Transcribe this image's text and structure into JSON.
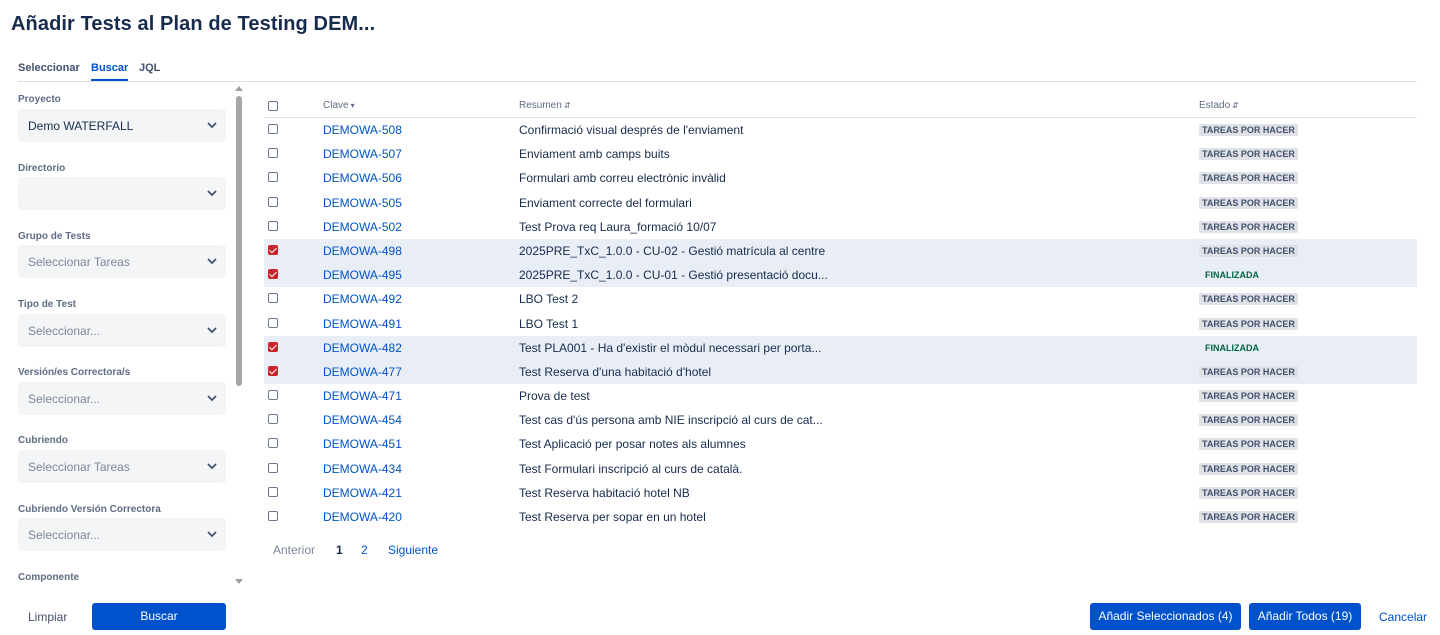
{
  "title": "Añadir Tests al Plan de Testing DEM...",
  "tabs": [
    "Seleccionar",
    "Buscar",
    "JQL"
  ],
  "active_tab": "Buscar",
  "filters": [
    {
      "label": "Proyecto",
      "value": "Demo WATERFALL",
      "placeholder": false
    },
    {
      "label": "Directorio",
      "value": "",
      "placeholder": false
    },
    {
      "label": "Grupo de Tests",
      "value": "Seleccionar Tareas",
      "placeholder": true
    },
    {
      "label": "Tipo de Test",
      "value": "Seleccionar...",
      "placeholder": true
    },
    {
      "label": "Versión/es Correctora/s",
      "value": "Seleccionar...",
      "placeholder": true
    },
    {
      "label": "Cubriendo",
      "value": "Seleccionar Tareas",
      "placeholder": true
    },
    {
      "label": "Cubriendo Versión Correctora",
      "value": "Seleccionar...",
      "placeholder": true
    },
    {
      "label": "Componente",
      "value": "",
      "placeholder": false
    }
  ],
  "table": {
    "columns": {
      "key": "Clave",
      "summary": "Resumen",
      "status": "Estado"
    },
    "rows": [
      {
        "checked": false,
        "key": "DEMOWA-508",
        "summary": "Confirmació visual després de l'enviament",
        "status": "TAREAS POR HACER",
        "status_type": "todo"
      },
      {
        "checked": false,
        "key": "DEMOWA-507",
        "summary": "Enviament amb camps buits",
        "status": "TAREAS POR HACER",
        "status_type": "todo"
      },
      {
        "checked": false,
        "key": "DEMOWA-506",
        "summary": "Formulari amb correu electrònic invàlid",
        "status": "TAREAS POR HACER",
        "status_type": "todo"
      },
      {
        "checked": false,
        "key": "DEMOWA-505",
        "summary": "Enviament correcte del formulari",
        "status": "TAREAS POR HACER",
        "status_type": "todo"
      },
      {
        "checked": false,
        "key": "DEMOWA-502",
        "summary": "Test Prova req Laura_formació 10/07",
        "status": "TAREAS POR HACER",
        "status_type": "todo"
      },
      {
        "checked": true,
        "key": "DEMOWA-498",
        "summary": "2025PRE_TxC_1.0.0 - CU-02 - Gestió matrícula al centre",
        "status": "TAREAS POR HACER",
        "status_type": "todo"
      },
      {
        "checked": true,
        "key": "DEMOWA-495",
        "summary": "2025PRE_TxC_1.0.0 - CU-01 - Gestió presentació docu...",
        "status": "FINALIZADA",
        "status_type": "done"
      },
      {
        "checked": false,
        "key": "DEMOWA-492",
        "summary": "LBO Test 2",
        "status": "TAREAS POR HACER",
        "status_type": "todo"
      },
      {
        "checked": false,
        "key": "DEMOWA-491",
        "summary": "LBO Test 1",
        "status": "TAREAS POR HACER",
        "status_type": "todo"
      },
      {
        "checked": true,
        "key": "DEMOWA-482",
        "summary": "Test PLA001 - Ha d'existir el mòdul necessari per porta...",
        "status": "FINALIZADA",
        "status_type": "done"
      },
      {
        "checked": true,
        "key": "DEMOWA-477",
        "summary": "Test Reserva d'una habitació d'hotel",
        "status": "TAREAS POR HACER",
        "status_type": "todo"
      },
      {
        "checked": false,
        "key": "DEMOWA-471",
        "summary": "Prova de test",
        "status": "TAREAS POR HACER",
        "status_type": "todo"
      },
      {
        "checked": false,
        "key": "DEMOWA-454",
        "summary": "Test cas d'ús persona amb NIE inscripció al curs de cat...",
        "status": "TAREAS POR HACER",
        "status_type": "todo"
      },
      {
        "checked": false,
        "key": "DEMOWA-451",
        "summary": "Test Aplicació per posar notes als alumnes",
        "status": "TAREAS POR HACER",
        "status_type": "todo"
      },
      {
        "checked": false,
        "key": "DEMOWA-434",
        "summary": "Test Formulari inscripció al curs de català.",
        "status": "TAREAS POR HACER",
        "status_type": "todo"
      },
      {
        "checked": false,
        "key": "DEMOWA-421",
        "summary": "Test Reserva habitació hotel NB",
        "status": "TAREAS POR HACER",
        "status_type": "todo"
      },
      {
        "checked": false,
        "key": "DEMOWA-420",
        "summary": "Test Reserva per sopar en un hotel",
        "status": "TAREAS POR HACER",
        "status_type": "todo"
      }
    ]
  },
  "pager": {
    "prev": "Anterior",
    "current": "1",
    "next_page": "2",
    "next": "Siguiente"
  },
  "buttons": {
    "clear": "Limpiar",
    "search": "Buscar",
    "add_selected": "Añadir Seleccionados (4)",
    "add_all": "Añadir Todos (19)",
    "cancel": "Cancelar"
  },
  "colors": {
    "primary": "#0052cc",
    "checkbox_checked": "#c9252c",
    "selected_row": "#e9eef6",
    "done_status": "#006644"
  }
}
